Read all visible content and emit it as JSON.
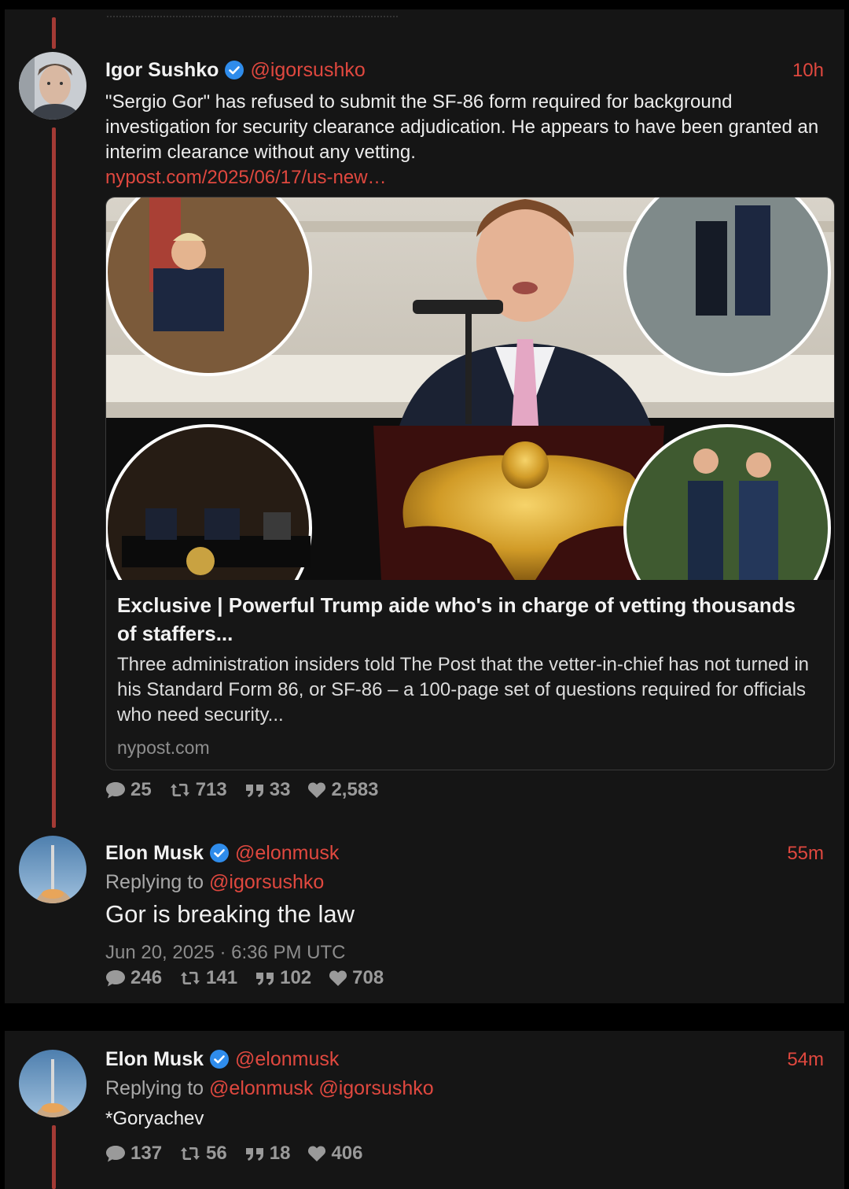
{
  "tweets": [
    {
      "name": "Igor Sushko",
      "handle": "@igorsushko",
      "time": "10h",
      "text": "\"Sergio Gor\" has refused to submit the SF-86 form required for background investigation for security clearance adjudication. He appears to have been granted an interim clearance without any vetting.",
      "link": "nypost.com/2025/06/17/us-new…",
      "card": {
        "title": "Exclusive | Powerful Trump aide who's in charge of vetting thousands of staffers...",
        "description": "Three administration insiders told The Post that the vetter-in-chief has not turned in his Standard Form 86, or SF-86 – a 100-page set of questions required for officials who need security...",
        "domain": "nypost.com"
      },
      "stats": {
        "replies": "25",
        "retweets": "713",
        "quotes": "33",
        "likes": "2,583"
      }
    },
    {
      "name": "Elon Musk",
      "handle": "@elonmusk",
      "time": "55m",
      "replying_label": "Replying to",
      "replying_to": "@igorsushko",
      "text": "Gor is breaking the law",
      "date": "Jun 20, 2025 · 6:36 PM UTC",
      "stats": {
        "replies": "246",
        "retweets": "141",
        "quotes": "102",
        "likes": "708"
      }
    },
    {
      "name": "Elon Musk",
      "handle": "@elonmusk",
      "time": "54m",
      "replying_label": "Replying to",
      "replying_to": "@elonmusk @igorsushko",
      "text": "*Goryachev",
      "stats": {
        "replies": "137",
        "retweets": "56",
        "quotes": "18",
        "likes": "406"
      }
    }
  ],
  "icons": [
    "reply-icon",
    "retweet-icon",
    "quote-icon",
    "like-icon",
    "verified-badge-icon"
  ],
  "colors": {
    "accent": "#e0483f",
    "background": "#151515",
    "thread_line": "#a33a35"
  }
}
